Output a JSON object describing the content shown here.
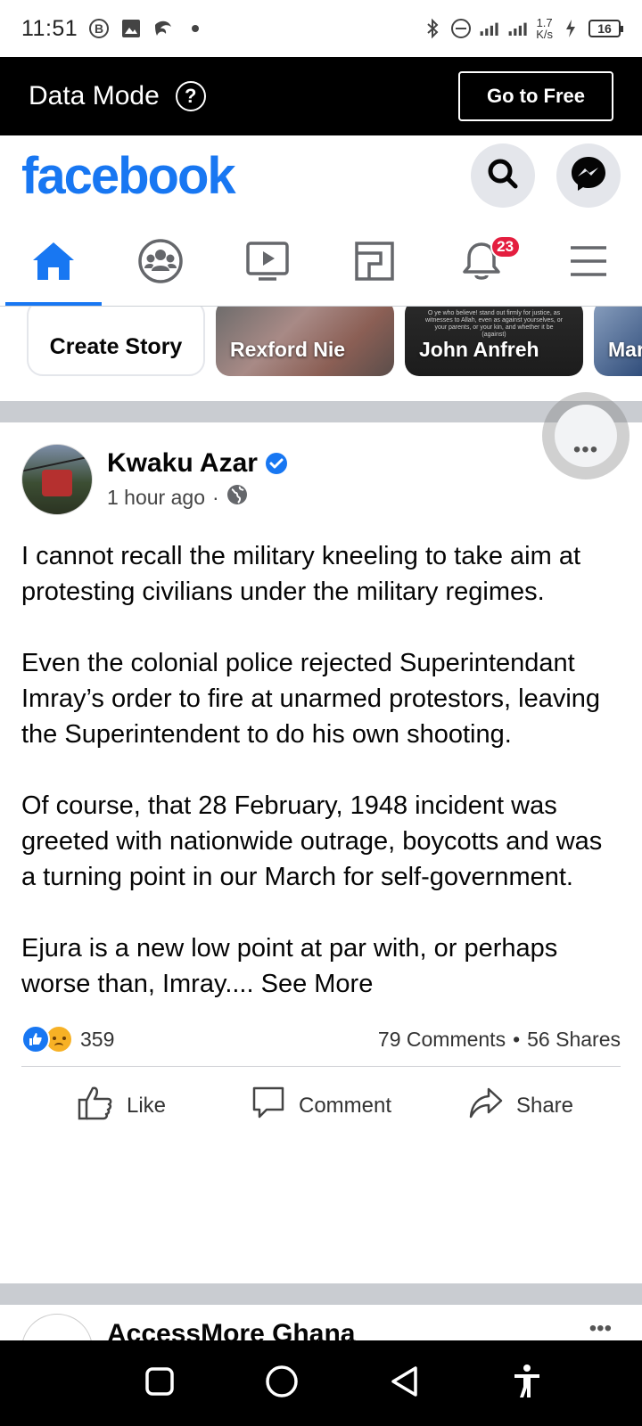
{
  "status_bar": {
    "time": "11:51",
    "net_speed_value": "1.7",
    "net_speed_unit": "K/s",
    "battery": "16"
  },
  "data_mode": {
    "label": "Data Mode",
    "help_glyph": "?",
    "go_free_label": "Go to Free"
  },
  "header": {
    "logo": "facebook",
    "brand_color": "#1877f2"
  },
  "tabs": [
    {
      "name": "home-icon",
      "active": true
    },
    {
      "name": "groups-icon",
      "active": false
    },
    {
      "name": "watch-icon",
      "active": false
    },
    {
      "name": "marketplace-icon",
      "active": false
    },
    {
      "name": "notifications-icon",
      "active": false,
      "badge": "23"
    },
    {
      "name": "menu-icon",
      "active": false
    }
  ],
  "stories": [
    {
      "label": "Create Story"
    },
    {
      "label": "Rexford Nie"
    },
    {
      "label": "John Anfreh",
      "overlay_text": "O ye who believe! stand out firmly for justice, as witnesses to Allah, even as against yourselves, or your parents, or your kin, and whether it be (against)"
    },
    {
      "label": "Mar"
    }
  ],
  "post": {
    "author": "Kwaku Azar",
    "time": "1 hour ago",
    "separator": "·",
    "paragraphs": [
      "I cannot recall the military kneeling to take aim at protesting civilians under the military regimes.",
      "Even the colonial police rejected Superintendant Imray’s order to fire at unarmed protestors, leaving the Superintendent to do his own shooting.",
      "Of course, that 28 February, 1948 incident was greeted with nationwide outrage, boycotts and was a turning point in our March for self-government."
    ],
    "last_paragraph": "Ejura is a new low point at par with, or perhaps worse than, Imray.... ",
    "see_more": "See More",
    "reaction_count": "359",
    "comments": "79 Comments",
    "shares": "56 Shares",
    "stats_separator": "•",
    "actions": {
      "like": "Like",
      "comment": "Comment",
      "share": "Share"
    },
    "more_glyph": "•••"
  },
  "next_post": {
    "author": "AccessMore Ghana",
    "more_glyph": "•••"
  }
}
